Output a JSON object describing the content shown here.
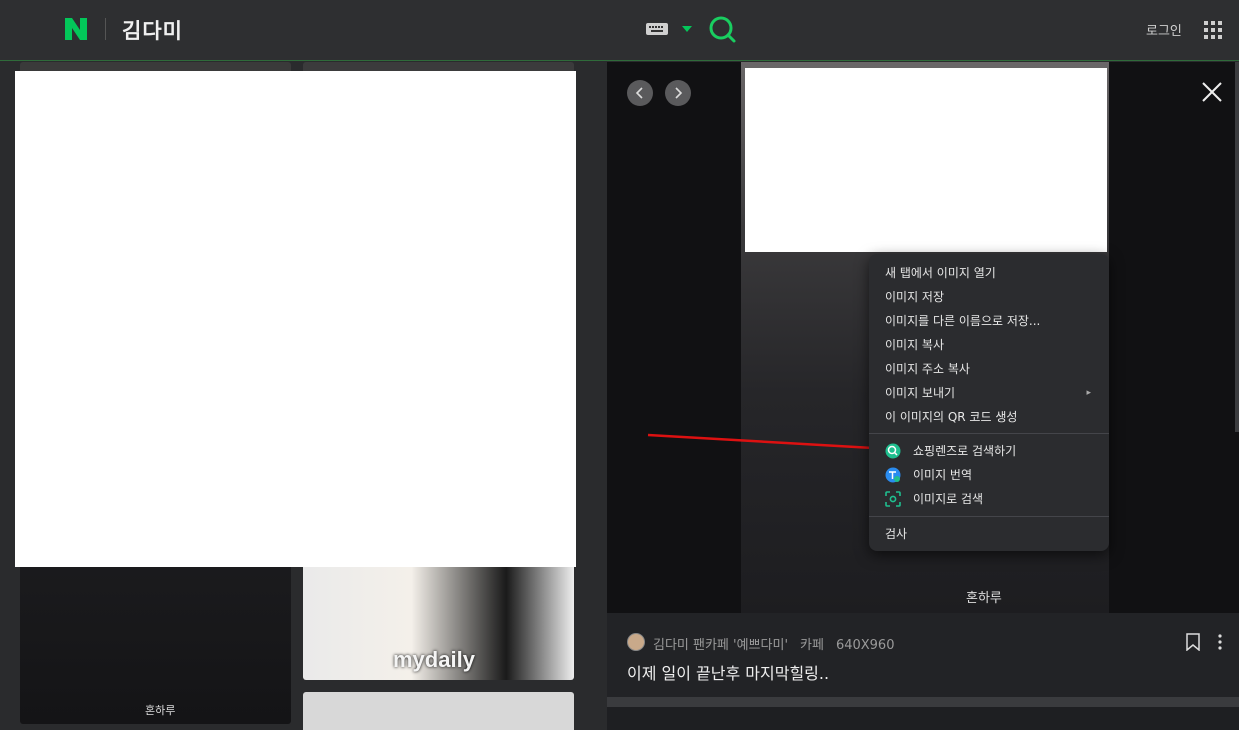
{
  "header": {
    "logo_letter": "N",
    "query": "김다미",
    "login_label": "로그인",
    "brand_color": "#03c75a"
  },
  "grid": {
    "watermark_mydaily": "mydaily",
    "watermark_left": "혼하루"
  },
  "viewer": {
    "watermark": "혼하루",
    "source": {
      "cafe_name": "김다미 팬카페 '예쁘다미'",
      "type": "카페",
      "dimensions": "640X960"
    },
    "caption": "이제 일이 끝난후 마지막힐링.."
  },
  "context_menu": {
    "items": [
      {
        "label": "새 탭에서 이미지 열기"
      },
      {
        "label": "이미지 저장"
      },
      {
        "label": "이미지를 다른 이름으로 저장..."
      },
      {
        "label": "이미지 복사"
      },
      {
        "label": "이미지 주소 복사"
      },
      {
        "label": "이미지 보내기"
      },
      {
        "label": "이 이미지의 QR 코드 생성"
      }
    ],
    "icon_items": [
      {
        "label": "쇼핑렌즈로 검색하기",
        "icon": "shopping-lens-icon"
      },
      {
        "label": "이미지 번역",
        "icon": "translate-icon"
      },
      {
        "label": "이미지로 검색",
        "icon": "lens-search-icon"
      }
    ],
    "inspect_label": "검사"
  }
}
